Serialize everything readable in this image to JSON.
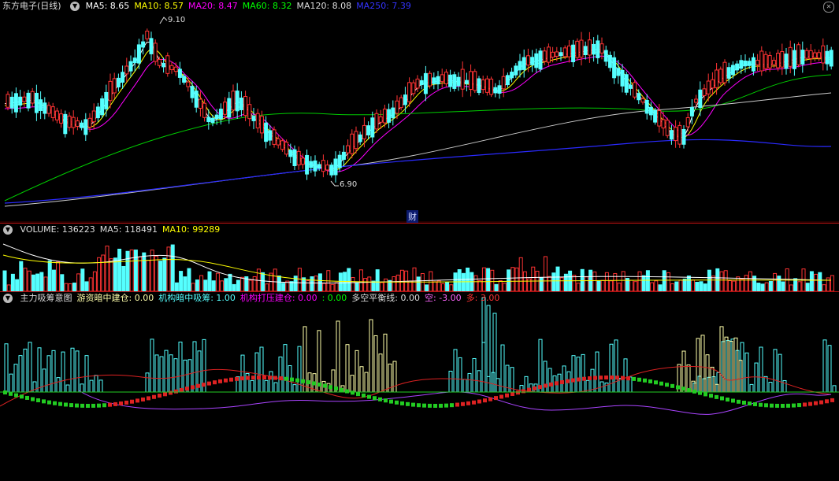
{
  "main_panel": {
    "title": "东方电子(日线)",
    "indicators": [
      {
        "label": "MA5: 8.65",
        "color": "#ffffff"
      },
      {
        "label": "MA10: 8.57",
        "color": "#ffff00"
      },
      {
        "label": "MA20: 8.47",
        "color": "#ff00ff"
      },
      {
        "label": "MA60: 8.32",
        "color": "#00ff00"
      },
      {
        "label": "MA120: 8.08",
        "color": "#dddddd"
      },
      {
        "label": "MA250: 7.39",
        "color": "#3333ff"
      }
    ],
    "high_label": "9.10",
    "low_label": "6.90",
    "cai_marker": "财"
  },
  "volume_panel": {
    "indicators": [
      {
        "label": "VOLUME: 136223",
        "color": "#dddddd"
      },
      {
        "label": "MA5: 118491",
        "color": "#dddddd"
      },
      {
        "label": "MA10: 99289",
        "color": "#ffff00"
      }
    ]
  },
  "indicator_panel": {
    "indicators": [
      {
        "label": "主力吸筹意图",
        "color": "#dddddd"
      },
      {
        "label": "游资暗中建仓: 0.00",
        "color": "#ffffaa"
      },
      {
        "label": "机构暗中吸筹: 1.00",
        "color": "#55ffff"
      },
      {
        "label": "机构打压建仓: 0.00",
        "color": "#ff00ff"
      },
      {
        "label": ": 0.00",
        "color": "#00ff00"
      },
      {
        "label": "多空平衡线: 0.00",
        "color": "#dddddd"
      },
      {
        "label": "空: -3.00",
        "color": "#ff66ff"
      },
      {
        "label": "多: 3.00",
        "color": "#ff3333"
      }
    ]
  },
  "colors": {
    "up": "#ff3333",
    "down": "#55ffff",
    "background": "#000000",
    "divider": "#b01010"
  }
}
